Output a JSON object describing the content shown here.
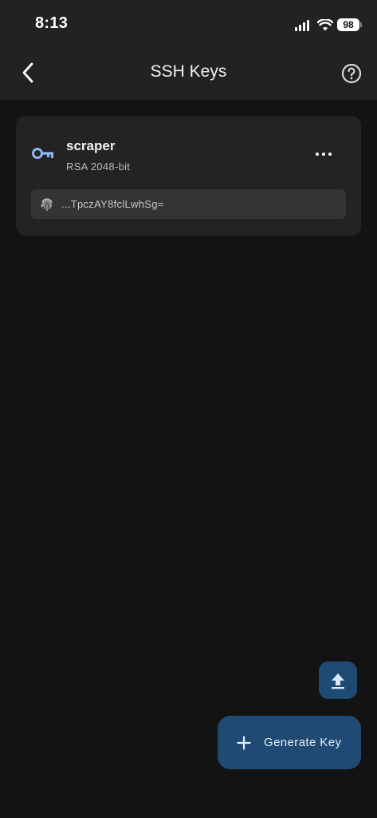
{
  "status_bar": {
    "time": "8:13",
    "battery": "98",
    "icons": [
      "signal-icon",
      "wifi-icon",
      "battery-icon"
    ]
  },
  "header": {
    "title": "SSH Keys",
    "back_icon": "chevron-left-icon",
    "help_icon": "help-circle-icon"
  },
  "keys": [
    {
      "name": "scraper",
      "type": "RSA 2048-bit",
      "fingerprint": "...TpczAY8fclLwhSg=",
      "icon": "key-icon",
      "menu_icon": "more-horizontal-icon"
    }
  ],
  "actions": {
    "upload_icon": "upload-icon",
    "generate_label": "Generate Key",
    "generate_icon": "plus-icon"
  },
  "colors": {
    "background": "#131313",
    "header": "#222222",
    "card": "#232323",
    "fingerprint_box": "#333436",
    "accent_button": "#1e4a74",
    "key_icon": "#8ab8f0"
  }
}
